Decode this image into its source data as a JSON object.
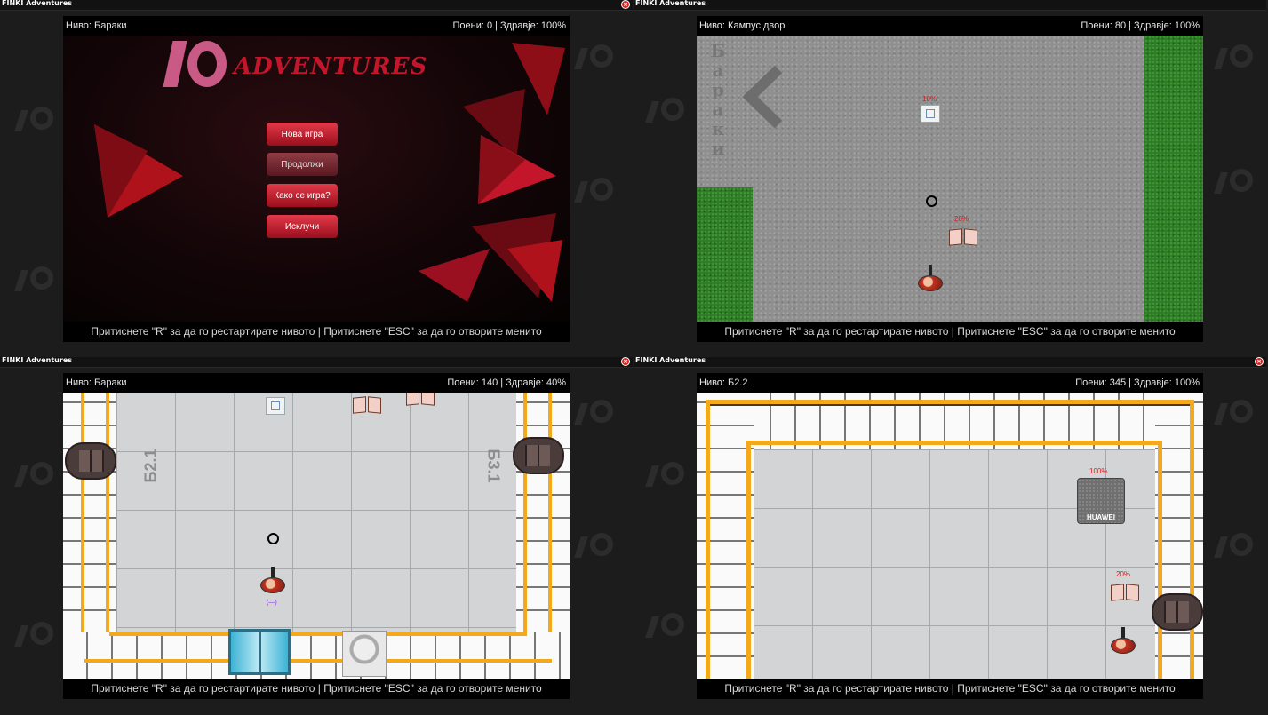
{
  "colors": {
    "accent_red": "#c4162a",
    "logo_pink": "#c85a85",
    "hud_text": "#e8e8e8",
    "floor_stripe": "#f4a81c",
    "grass": "#2e7a26",
    "percent_red": "#e01818"
  },
  "windows": [
    {
      "title": "FINKI Adventures",
      "close_icon": "close-icon",
      "hud": {
        "level": "Ниво: Бараки",
        "score": "Поени: 0 | Здравје: 100%"
      },
      "footer": "Притиснете \"R\" за да го рестартирате нивото | Притиснете \"ESC\" за да го отворите менито",
      "menu": {
        "logo_text": "ADVENTURES",
        "buttons": [
          {
            "label": "Нова игра"
          },
          {
            "label": "Продолжи"
          },
          {
            "label": "Како се игра?"
          },
          {
            "label": "Исклучи"
          }
        ]
      }
    },
    {
      "title": "FINKI Adventures",
      "close_icon": "close-icon",
      "hud": {
        "level": "Ниво: Кампус двор",
        "score": "Поени: 80 | Здравје: 100%"
      },
      "footer": "Притиснете \"R\" за да го рестартирате нивото | Притиснете \"ESC\" за да го отворите менито",
      "scene": {
        "exit_label": "Бараки",
        "items": [
          {
            "icon": "tablet-icon",
            "percent": "10%"
          },
          {
            "icon": "book-icon",
            "percent": "20%"
          }
        ]
      }
    },
    {
      "title": "FINKI Adventures",
      "close_icon": "close-icon",
      "hud": {
        "level": "Ниво: Бараки",
        "score": "Поени: 140 | Здравје: 40%"
      },
      "footer": "Притиснете \"R\" за да го рестартирате нивото | Притиснете \"ESC\" за да го отворите менито",
      "scene": {
        "left_room": "Б2.1",
        "right_room": "Б3.1",
        "player_tag": "(—)"
      }
    },
    {
      "title": "FINKI Adventures",
      "close_icon": "close-icon",
      "hud": {
        "level": "Ниво: Б2.2",
        "score": "Поени: 345 | Здравје: 100%"
      },
      "footer": "Притиснете \"R\" за да го рестартирате нивото | Притиснете \"ESC\" за да го отворите менито",
      "scene": {
        "server_label": "HUAWEI",
        "server_percent": "100%",
        "book_percent": "20%"
      }
    }
  ]
}
